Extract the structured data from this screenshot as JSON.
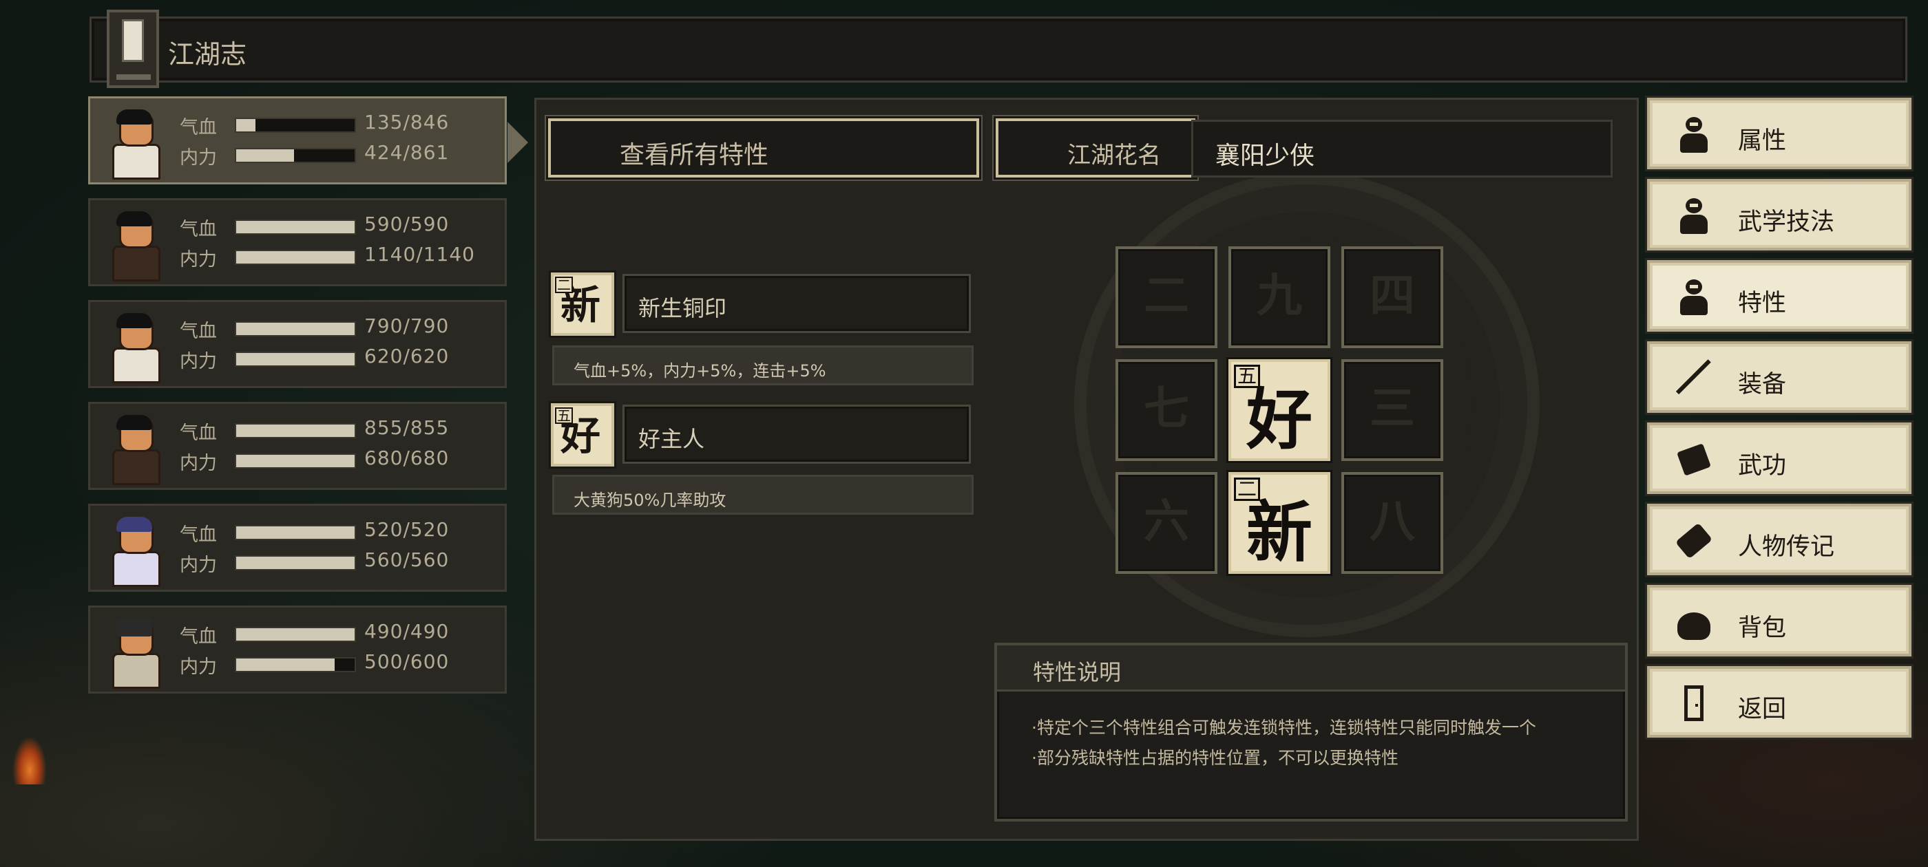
{
  "window": {
    "title": "江湖志"
  },
  "party": [
    {
      "hp": "135/846",
      "hp_frac": 0.16,
      "mp": "424/861",
      "mp_frac": 0.49,
      "selected": true
    },
    {
      "hp": "590/590",
      "hp_frac": 1.0,
      "mp": "1140/1140",
      "mp_frac": 1.0
    },
    {
      "hp": "790/790",
      "hp_frac": 1.0,
      "mp": "620/620",
      "mp_frac": 1.0
    },
    {
      "hp": "855/855",
      "hp_frac": 1.0,
      "mp": "680/680",
      "mp_frac": 1.0
    },
    {
      "hp": "520/520",
      "hp_frac": 1.0,
      "mp": "560/560",
      "mp_frac": 1.0
    },
    {
      "hp": "490/490",
      "hp_frac": 1.0,
      "mp": "500/600",
      "mp_frac": 0.83
    }
  ],
  "labels": {
    "hp": "气血",
    "mp": "内力"
  },
  "top": {
    "view_all": "查看所有特性",
    "nickname_label": "江湖花名",
    "nickname_value": "襄阳少侠"
  },
  "traits": [
    {
      "icon_big": "新",
      "icon_small": "二",
      "name": "新生铜印",
      "desc": "气血+5%，内力+5%，连击+5%"
    },
    {
      "icon_big": "好",
      "icon_small": "五",
      "name": "好主人",
      "desc": "大黄狗50%几率助攻"
    }
  ],
  "grid": [
    {
      "num": "二"
    },
    {
      "num": "九"
    },
    {
      "num": "四"
    },
    {
      "num": "七"
    },
    {
      "big": "好",
      "small": "五"
    },
    {
      "num": "三"
    },
    {
      "num": "六"
    },
    {
      "big": "新",
      "small": "二"
    },
    {
      "num": "八"
    }
  ],
  "explain": {
    "title": "特性说明",
    "lines": [
      "·特定个三个特性组合可触发连锁特性，连锁特性只能同时触发一个",
      "·部分残缺特性占据的特性位置，不可以更换特性"
    ]
  },
  "menu": [
    {
      "label": "属性",
      "icon": "person-icon"
    },
    {
      "label": "武学技法",
      "icon": "person-sparkle-icon"
    },
    {
      "label": "特性",
      "icon": "person-heart-icon",
      "active": true
    },
    {
      "label": "装备",
      "icon": "sword-icon"
    },
    {
      "label": "武功",
      "icon": "book-icon"
    },
    {
      "label": "人物传记",
      "icon": "scroll-icon"
    },
    {
      "label": "背包",
      "icon": "bag-icon"
    },
    {
      "label": "返回",
      "icon": "door-icon"
    }
  ]
}
